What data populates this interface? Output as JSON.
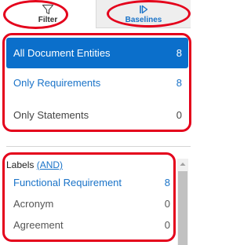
{
  "tabs": {
    "filter": {
      "label": "Filter",
      "icon": "filter-icon"
    },
    "baselines": {
      "label": "Baselines",
      "icon": "baselines-icon"
    }
  },
  "entity_options": [
    {
      "label": "All Document Entities",
      "count": "8",
      "selected": true
    },
    {
      "label": "Only Requirements",
      "count": "8"
    },
    {
      "label": "Only Statements",
      "count": "0"
    }
  ],
  "labels": {
    "title": "Labels",
    "mode_link": "(AND)",
    "items": [
      {
        "name": "Functional Requirement",
        "count": "8"
      },
      {
        "name": "Acronym",
        "count": "0"
      },
      {
        "name": "Agreement",
        "count": "0"
      }
    ]
  },
  "colors": {
    "accent": "#0b6fcb",
    "link": "#1a73c8",
    "annotation": "#e4001b"
  }
}
